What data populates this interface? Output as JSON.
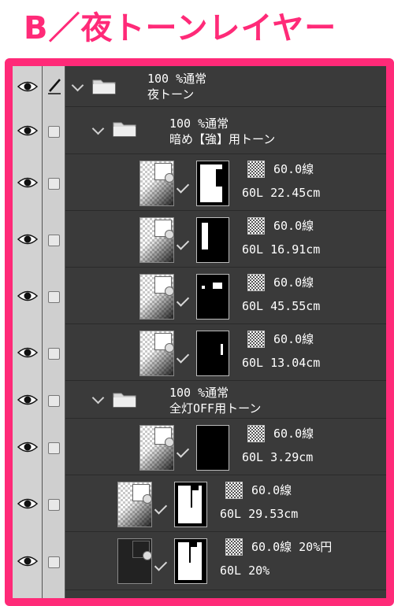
{
  "heading": "B／夜トーンレイヤー",
  "colors": {
    "accent": "#ff2a78",
    "selected_row": "#5f7188",
    "panel_bg": "#3a3a3a"
  },
  "root_folder": {
    "blend": "100 %通常",
    "name": "夜トーン"
  },
  "subfolder_1": {
    "blend": "100 %通常",
    "name": "暗め【強】用トーン"
  },
  "subfolder_2": {
    "blend": "100 %通常",
    "name": "全灯OFF用トーン"
  },
  "layers": [
    {
      "tone": "60.0線",
      "info": "60L 22.45cm"
    },
    {
      "tone": "60.0線",
      "info": "60L 16.91cm"
    },
    {
      "tone": "60.0線",
      "info": "60L 45.55cm"
    },
    {
      "tone": "60.0線",
      "info": "60L 13.04cm"
    },
    {
      "tone": "60.0線",
      "info": "60L 3.29cm"
    },
    {
      "tone": "60.0線",
      "info": "60L 29.53cm"
    },
    {
      "tone": "60.0線 20%円",
      "info": "60L 20%"
    }
  ],
  "icons": {
    "visibility": "eye-icon",
    "edit": "pencil-icon",
    "folder": "folder-icon",
    "expand": "chevron-down-icon"
  }
}
